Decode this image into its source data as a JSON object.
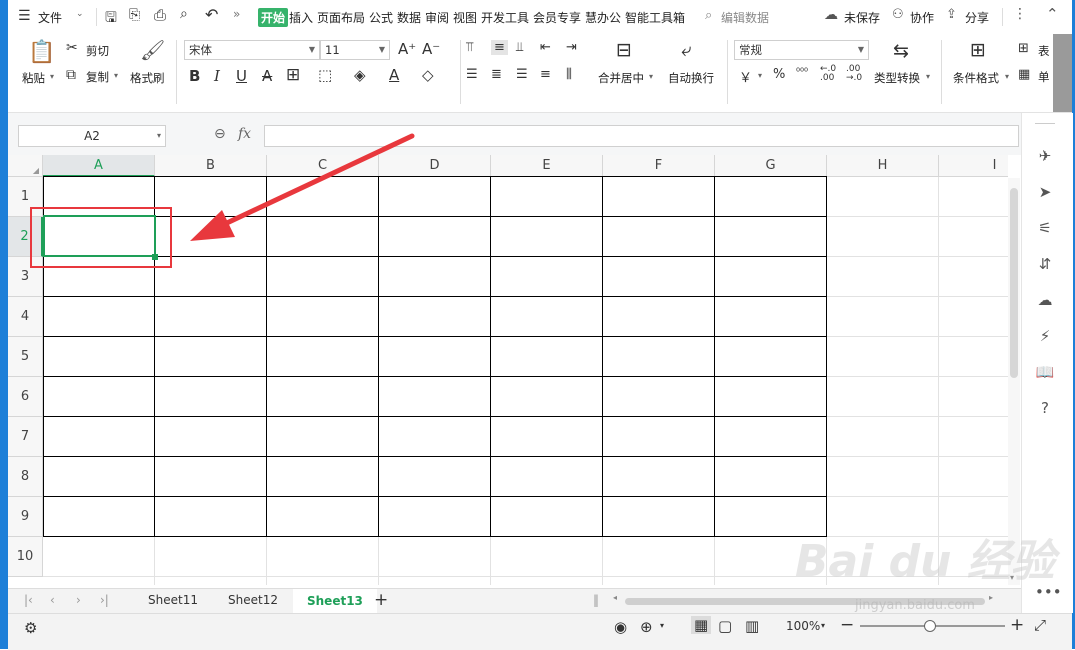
{
  "menubar": {
    "file": "文件",
    "tabs": [
      "开始",
      "插入",
      "页面布局",
      "公式",
      "数据",
      "审阅",
      "视图",
      "开发工具",
      "会员专享",
      "慧办公",
      "智能工具箱"
    ],
    "search_placeholder": "编辑数据",
    "unsaved": "未保存",
    "collab": "协作",
    "share": "分享"
  },
  "ribbon": {
    "paste": "粘贴",
    "cut": "剪切",
    "copy": "复制",
    "format_painter": "格式刷",
    "font_name": "宋体",
    "font_size": "11",
    "merge_center": "合并居中",
    "wrap_text": "自动换行",
    "number_format": "常规",
    "type_convert": "类型转换",
    "cond_format": "条件格式",
    "table_style_partial": "表",
    "cell_partial": "单",
    "bold": "B",
    "italic": "I",
    "underline": "U",
    "strike": "A",
    "currency": "￥",
    "percent": "%",
    "thousands": "⁰⁰⁰",
    "dec_inc": "←.0\n.00",
    "dec_dec": ".00\n→.0"
  },
  "formula_bar": {
    "name_box": "A2",
    "fx": "fx"
  },
  "columns": [
    "A",
    "B",
    "C",
    "D",
    "E",
    "F",
    "G",
    "H",
    "I"
  ],
  "rows": [
    "1",
    "2",
    "3",
    "4",
    "5",
    "6",
    "7",
    "8",
    "9",
    "10"
  ],
  "selected": {
    "col": "A",
    "row": "2"
  },
  "sheets": [
    "Sheet11",
    "Sheet12",
    "Sheet13"
  ],
  "active_sheet": "Sheet13",
  "status": {
    "zoom": "100%"
  },
  "watermark": {
    "brand": "Bai du 经验",
    "url": "jingyan.baidu.com"
  },
  "colors": {
    "accent": "#1e9f58",
    "annotation": "#e8383d",
    "frame": "#1d7fd8"
  }
}
